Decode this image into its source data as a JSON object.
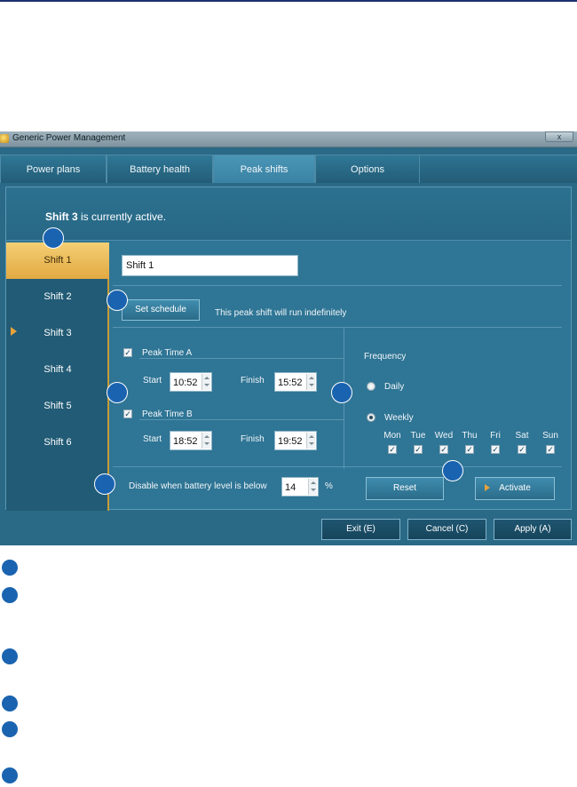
{
  "window": {
    "title": "Generic Power Management",
    "close_label": "x"
  },
  "tabs": [
    {
      "label": "Power plans",
      "active": false
    },
    {
      "label": "Battery health",
      "active": false
    },
    {
      "label": "Peak shifts",
      "active": true
    },
    {
      "label": "Options",
      "active": false
    }
  ],
  "status": {
    "active_shift": "Shift 3",
    "suffix": "is currently active."
  },
  "shifts": [
    {
      "label": "Shift 1",
      "selected": true
    },
    {
      "label": "Shift 2"
    },
    {
      "label": "Shift 3",
      "active": true
    },
    {
      "label": "Shift 4"
    },
    {
      "label": "Shift 5"
    },
    {
      "label": "Shift 6"
    }
  ],
  "detail": {
    "shift_name": "Shift 1",
    "set_schedule_label": "Set schedule",
    "schedule_info": "This peak shift will run indefinitely",
    "peak_a": {
      "label": "Peak Time A",
      "checked": true,
      "start_label": "Start",
      "start": "10:52",
      "finish_label": "Finish",
      "finish": "15:52"
    },
    "peak_b": {
      "label": "Peak Time B",
      "checked": true,
      "start_label": "Start",
      "start": "18:52",
      "finish_label": "Finish",
      "finish": "19:52"
    },
    "battery": {
      "label": "Disable when battery level is below",
      "value": "14",
      "unit": "%"
    }
  },
  "frequency": {
    "label": "Frequency",
    "daily_label": "Daily",
    "weekly_label": "Weekly",
    "selected": "Weekly",
    "days": [
      {
        "label": "Mon",
        "checked": true
      },
      {
        "label": "Tue",
        "checked": true
      },
      {
        "label": "Wed",
        "checked": true
      },
      {
        "label": "Thu",
        "checked": true
      },
      {
        "label": "Fri",
        "checked": true
      },
      {
        "label": "Sat",
        "checked": true
      },
      {
        "label": "Sun",
        "checked": true
      }
    ]
  },
  "actions": {
    "reset_label": "Reset",
    "activate_label": "Activate"
  },
  "footer": {
    "exit_label": "Exit (E)",
    "cancel_label": "Cancel (C)",
    "apply_label": "Apply (A)"
  },
  "colors": {
    "callout": "#1a63b0",
    "selected_shift": "#e2a942",
    "window_bg": "#2b6a86"
  }
}
